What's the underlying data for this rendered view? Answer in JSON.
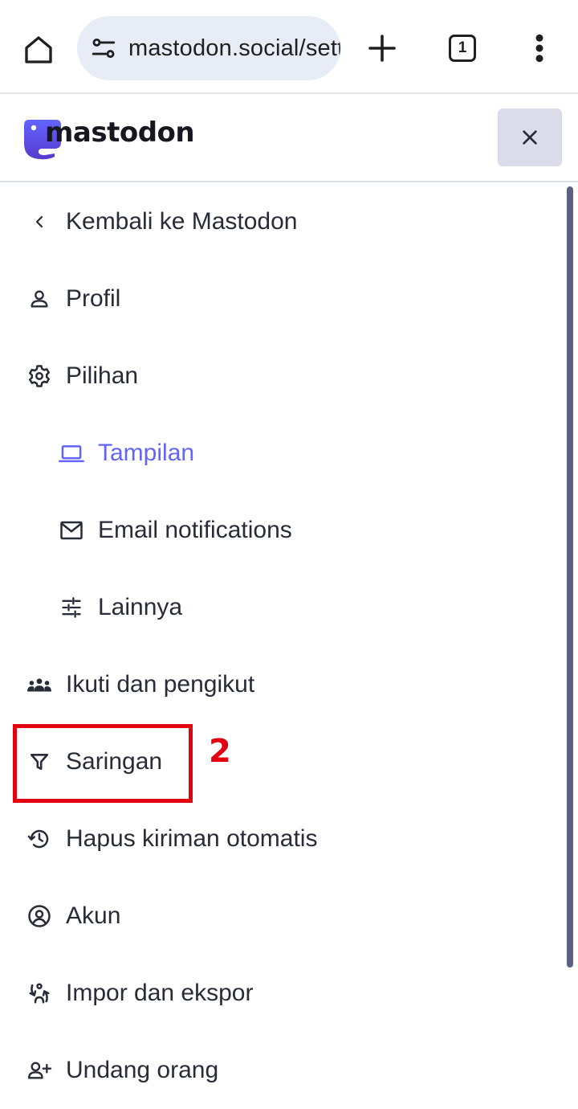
{
  "browser": {
    "url": "mastodon.social/settings/preferences/appearance",
    "tab_count": "1"
  },
  "header": {
    "logo_text": "mastodon"
  },
  "nav": {
    "items": [
      {
        "label": "Kembali ke Mastodon",
        "icon": "chevron-left-icon"
      },
      {
        "label": "Profil",
        "icon": "person-icon"
      },
      {
        "label": "Pilihan",
        "icon": "gear-icon"
      },
      {
        "label": "Tampilan",
        "icon": "laptop-icon",
        "active": true
      },
      {
        "label": "Email notifications",
        "icon": "mail-icon"
      },
      {
        "label": "Lainnya",
        "icon": "sliders-icon"
      },
      {
        "label": "Ikuti dan pengikut",
        "icon": "people-icon"
      },
      {
        "label": "Saringan",
        "icon": "filter-icon"
      },
      {
        "label": "Hapus kiriman otomatis",
        "icon": "history-icon"
      },
      {
        "label": "Akun",
        "icon": "account-circle-icon"
      },
      {
        "label": "Impor dan ekspor",
        "icon": "import-export-icon"
      },
      {
        "label": "Undang orang",
        "icon": "person-add-icon"
      }
    ]
  },
  "annotation": {
    "number": "2"
  },
  "colors": {
    "accent": "#6364ff",
    "annotation": "#e3000f",
    "close_bg": "#dcdbe9",
    "omnibox_bg": "#e7ecf6"
  }
}
